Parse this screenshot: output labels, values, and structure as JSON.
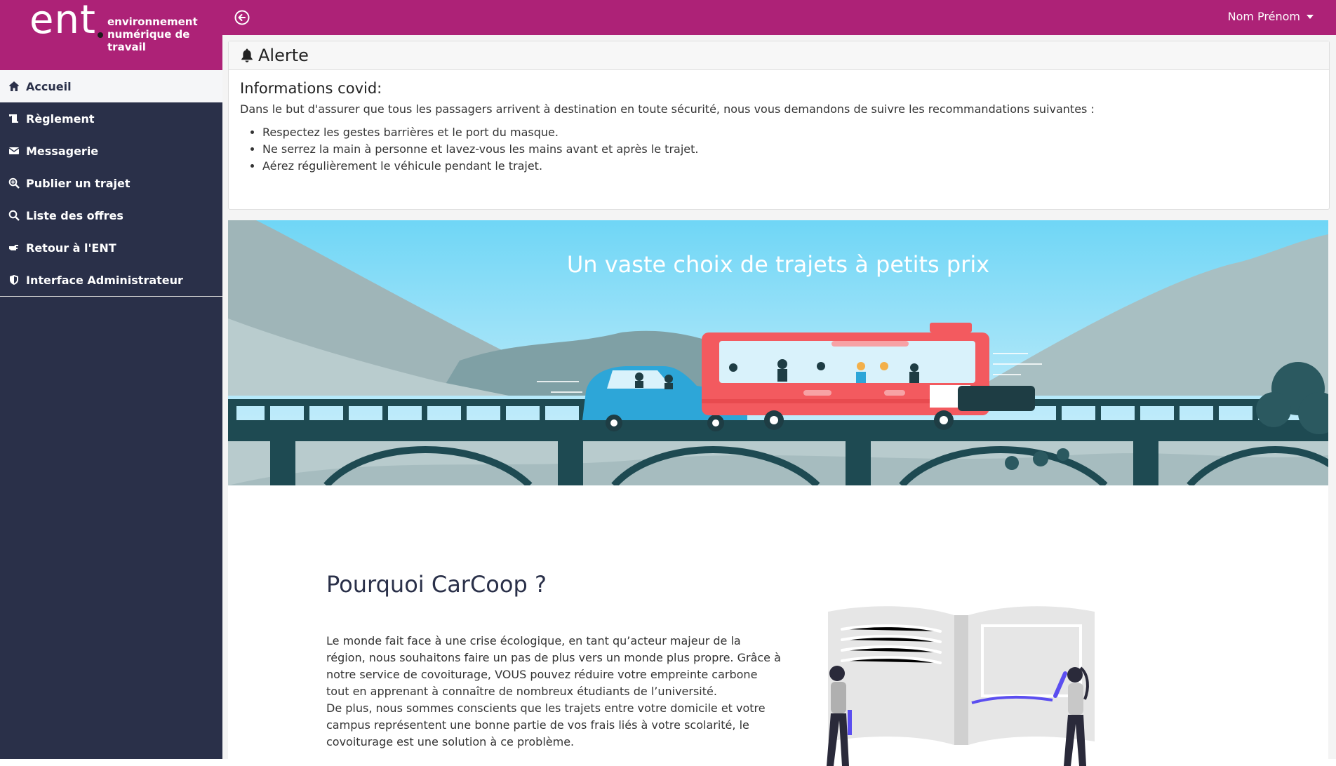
{
  "brand": {
    "logo": "ent",
    "tagline_1": "environnement",
    "tagline_2": "numérique de",
    "tagline_3": "travail"
  },
  "sidebar": {
    "items": [
      {
        "label": "Accueil",
        "icon": "home-icon",
        "active": true
      },
      {
        "label": "Règlement",
        "icon": "scroll-icon"
      },
      {
        "label": "Messagerie",
        "icon": "envelope-icon"
      },
      {
        "label": "Publier un trajet",
        "icon": "search-plus-icon"
      },
      {
        "label": "Liste des offres",
        "icon": "search-icon"
      },
      {
        "label": "Retour à l'ENT",
        "icon": "hand-point-icon"
      },
      {
        "label": "Interface Administrateur",
        "icon": "shield-icon"
      }
    ]
  },
  "topbar": {
    "user_name": "Nom Prénom"
  },
  "alert": {
    "title": "Alerte",
    "heading": "Informations covid:",
    "intro": "Dans le but d'assurer que tous les passagers arrivent à destination en toute sécurité, nous vous demandons de suivre les recommandations suivantes :",
    "items": [
      "Respectez les gestes barrières et le port du masque.",
      "Ne serrez la main à personne et lavez-vous les mains avant et après le trajet.",
      "Aérez régulièrement le véhicule pendant le trajet."
    ]
  },
  "banner": {
    "title": "Un vaste choix de trajets à petits prix"
  },
  "why": {
    "title": "Pourquoi CarCoop ?",
    "paragraph_1": "Le monde fait face à une crise écologique, en tant qu’acteur majeur de la région, nous souhaitons faire un pas de plus vers un monde plus propre. Grâce à notre service de covoiturage, VOUS pouvez réduire votre empreinte carbone tout en apprenant à connaître de nombreux étudiants de l’université.",
    "paragraph_2": "De plus, nous sommes conscients que les trajets entre votre domicile et votre campus représentent une bonne partie de vos frais liés à votre scolarité, le covoiturage est une solution à ce problème."
  },
  "colors": {
    "brand": "#ad2277",
    "sidebar": "#2a3049",
    "sky": "#7ad8f3"
  }
}
